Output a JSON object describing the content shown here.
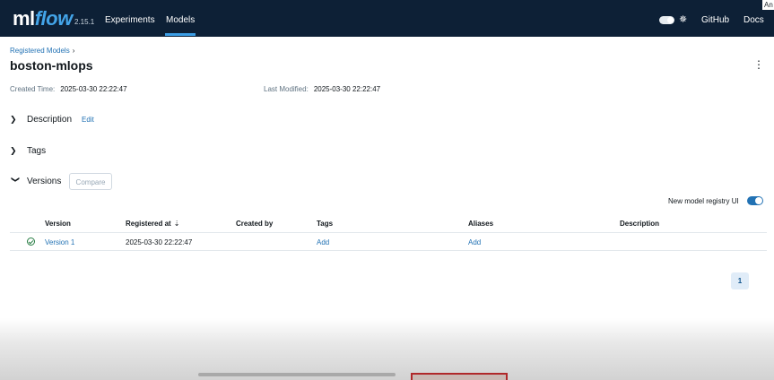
{
  "header": {
    "logo_ml": "ml",
    "logo_flow": "flow",
    "version": "2.15.1",
    "nav": [
      {
        "label": "Experiments"
      },
      {
        "label": "Models"
      }
    ],
    "github_label": "GitHub",
    "docs_label": "Docs",
    "user_label": "An",
    "theme_icon": "sun-icon",
    "colors": {
      "background": "#0d2036",
      "accent": "#3c9ee5",
      "logo_flow": "#43a4e8"
    }
  },
  "breadcrumb": {
    "label": "Registered Models",
    "separator": "›"
  },
  "page": {
    "title": "boston-mlops",
    "created_label": "Created Time:",
    "created_value": "2025-03-30 22:22:47",
    "modified_label": "Last Modified:",
    "modified_value": "2025-03-30 22:22:47"
  },
  "sections": {
    "description_label": "Description",
    "edit_label": "Edit",
    "tags_label": "Tags",
    "versions_label": "Versions",
    "compare_label": "Compare"
  },
  "registry_toggle": {
    "label": "New model registry UI",
    "enabled": true
  },
  "table": {
    "columns": [
      "Version",
      "Registered at",
      "Created by",
      "Tags",
      "Aliases",
      "Description"
    ],
    "rows": [
      {
        "status_icon": "check-circle-icon",
        "version": "Version 1",
        "registered_at": "2025-03-30 22:22:47",
        "created_by": "",
        "tags": "Add",
        "aliases": "Add",
        "description": ""
      }
    ]
  },
  "pagination": {
    "current_page": "1"
  }
}
